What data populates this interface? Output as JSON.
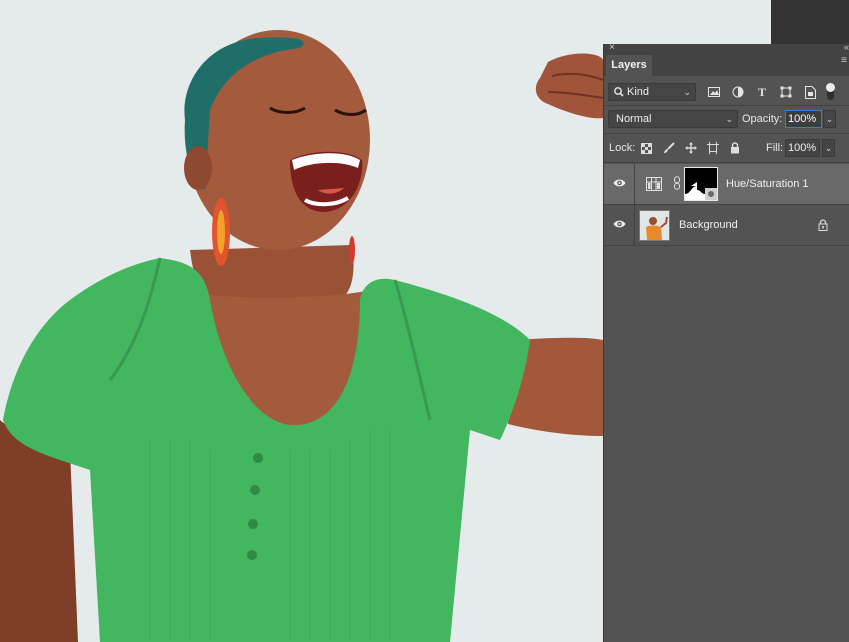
{
  "panel": {
    "close_glyph": "×",
    "collapse_glyph": "«",
    "tab_label": "Layers",
    "menu_glyph": "≡"
  },
  "filter": {
    "kind_label": "Kind",
    "icons": [
      "pixel-layer-filter-icon",
      "adjustment-layer-filter-icon",
      "type-layer-filter-icon",
      "shape-layer-filter-icon",
      "smart-object-filter-icon"
    ]
  },
  "blend": {
    "mode": "Normal",
    "opacity_label": "Opacity:",
    "opacity_value": "100%"
  },
  "lock": {
    "label": "Lock:",
    "fill_label": "Fill:",
    "fill_value": "100%"
  },
  "layers": [
    {
      "name": "Hue/Saturation 1",
      "visible": true,
      "selected": true,
      "type": "adjustment"
    },
    {
      "name": "Background",
      "visible": true,
      "selected": false,
      "locked": true
    }
  ],
  "colors": {
    "panel_bg": "#535353",
    "selected_row": "#696969",
    "focus_accent": "#3d7bd0",
    "shirt_green": "#43b660"
  }
}
